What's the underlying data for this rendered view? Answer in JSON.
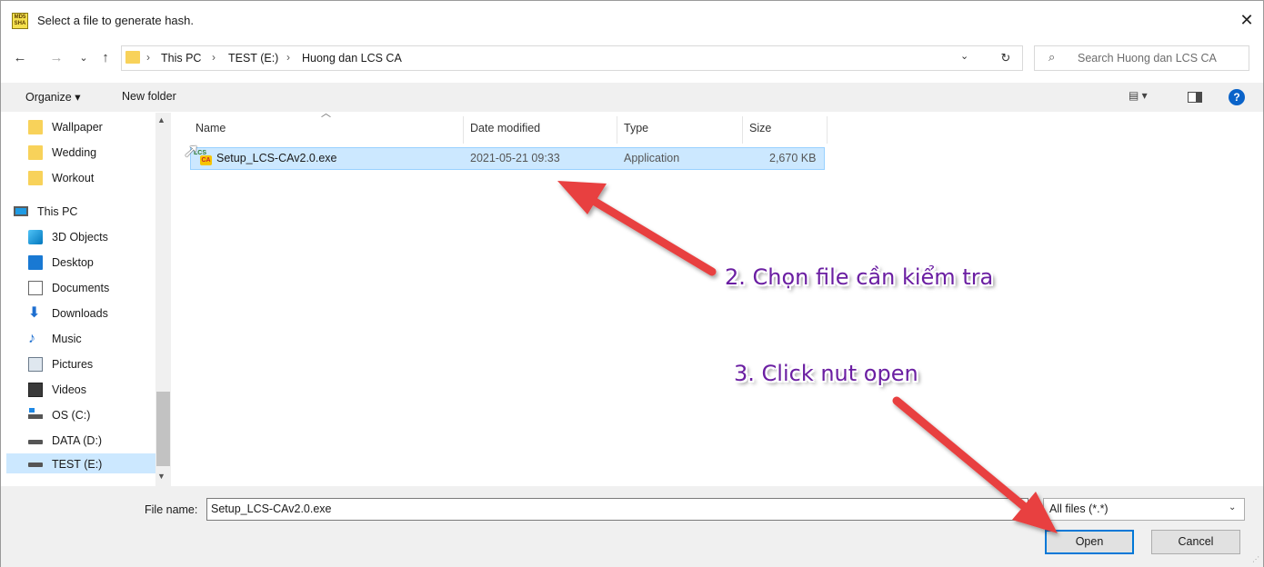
{
  "window": {
    "title": "Select a file to generate hash.",
    "app_icon_text": "MD5 SHA",
    "close_glyph": "✕"
  },
  "nav": {
    "back": "←",
    "forward": "→",
    "recent": "⌄",
    "up": "↑",
    "breadcrumbs": [
      "This PC",
      "TEST (E:)",
      "Huong dan LCS CA"
    ],
    "separator": "›",
    "dropdown": "⌄",
    "refresh": "↻",
    "search_placeholder": "Search Huong dan LCS CA",
    "search_icon": "⌕"
  },
  "commands": {
    "organize": "Organize ▾",
    "new_folder": "New folder",
    "view_options": "▤ ▾",
    "help": "?"
  },
  "sidebar": {
    "items": [
      {
        "label": "Wallpaper",
        "icon": "folder-icon"
      },
      {
        "label": "Wedding",
        "icon": "folder-icon"
      },
      {
        "label": "Workout",
        "icon": "folder-icon"
      },
      {
        "label": "This PC",
        "icon": "pc-icon"
      },
      {
        "label": "3D Objects",
        "icon": "3d-objects-icon"
      },
      {
        "label": "Desktop",
        "icon": "desktop-icon"
      },
      {
        "label": "Documents",
        "icon": "documents-icon"
      },
      {
        "label": "Downloads",
        "icon": "downloads-icon"
      },
      {
        "label": "Music",
        "icon": "music-icon"
      },
      {
        "label": "Pictures",
        "icon": "pictures-icon"
      },
      {
        "label": "Videos",
        "icon": "videos-icon"
      },
      {
        "label": "OS (C:)",
        "icon": "os-drive-icon"
      },
      {
        "label": "DATA (D:)",
        "icon": "drive-icon"
      },
      {
        "label": "TEST (E:)",
        "icon": "drive-icon",
        "selected": true
      }
    ],
    "scroll_up": "▲",
    "scroll_down": "▼"
  },
  "file_list": {
    "columns": [
      "Name",
      "Date modified",
      "Type",
      "Size"
    ],
    "sort_indicator": "︿",
    "rows": [
      {
        "name": "Setup_LCS-CAv2.0.exe",
        "date": "2021-05-21 09:33",
        "type": "Application",
        "size": "2,670 KB",
        "icon_top": "LCS",
        "icon_badge": "CA"
      }
    ]
  },
  "footer": {
    "file_name_label": "File name:",
    "file_name_value": "Setup_LCS-CAv2.0.exe",
    "filter_value": "All files (*.*)",
    "filter_arrow": "⌄",
    "open_label": "Open",
    "cancel_label": "Cancel"
  },
  "annotations": {
    "step2": "2. Chọn file cần kiểm tra",
    "step3": "3. Click nut open",
    "arrow_color": "#e8403f"
  }
}
